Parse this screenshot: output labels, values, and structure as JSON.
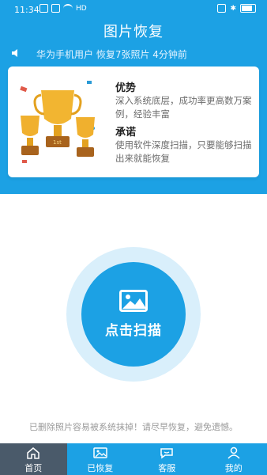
{
  "status_bar": {
    "time": "11:34",
    "network": "HD"
  },
  "header": {
    "title": "图片恢复"
  },
  "notice": {
    "text": "华为手机用户 恢复7张照片 4分钟前"
  },
  "card": {
    "advantage": {
      "title": "优势",
      "desc": "深入系统底层，成功率更高数万案例，经验丰富"
    },
    "promise": {
      "title": "承诺",
      "desc": "使用软件深度扫描，只要能够扫描出来就能恢复"
    }
  },
  "scan": {
    "label": "点击扫描"
  },
  "warning": {
    "text": "已删除照片容易被系统抹掉！请尽早恢复，避免遗憾。"
  },
  "tabs": [
    {
      "label": "首页",
      "icon": "home-icon"
    },
    {
      "label": "已恢复",
      "icon": "image-icon"
    },
    {
      "label": "客服",
      "icon": "chat-icon"
    },
    {
      "label": "我的",
      "icon": "user-icon"
    }
  ],
  "colors": {
    "primary": "#1ca1e4",
    "active_tab": "#4a5a6a",
    "scan_ring": "#d9effb"
  }
}
